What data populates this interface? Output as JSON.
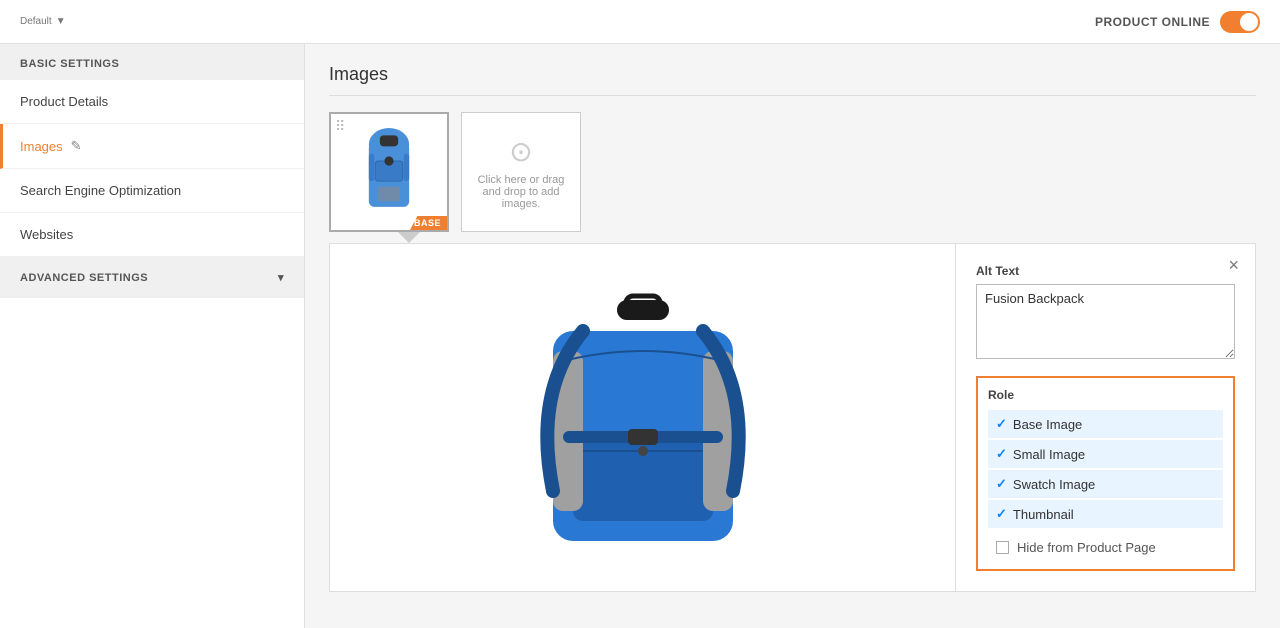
{
  "topbar": {
    "default_label": "Default",
    "product_online_label": "PRODUCT ONLINE"
  },
  "sidebar": {
    "basic_settings_label": "BASIC SETTINGS",
    "items": [
      {
        "id": "product-details",
        "label": "Product Details",
        "active": false
      },
      {
        "id": "images",
        "label": "Images",
        "active": true,
        "has_edit": true
      },
      {
        "id": "seo",
        "label": "Search Engine Optimization",
        "active": false
      },
      {
        "id": "websites",
        "label": "Websites",
        "active": false
      }
    ],
    "advanced_settings_label": "ADVANCED SETTINGS"
  },
  "content": {
    "section_title": "Images",
    "upload_text": "Click here or drag and drop to add images.",
    "alt_text_label": "Alt Text",
    "alt_text_value": "Fusion Backpack",
    "role_label": "Role",
    "role_items": [
      {
        "id": "base-image",
        "label": "Base Image",
        "checked": true
      },
      {
        "id": "small-image",
        "label": "Small Image",
        "checked": true
      },
      {
        "id": "swatch-image",
        "label": "Swatch Image",
        "checked": true
      },
      {
        "id": "thumbnail",
        "label": "Thumbnail",
        "checked": true
      }
    ],
    "hide_label": "Hide from Product Page",
    "base_badge": "BASE",
    "close_icon": "×"
  }
}
